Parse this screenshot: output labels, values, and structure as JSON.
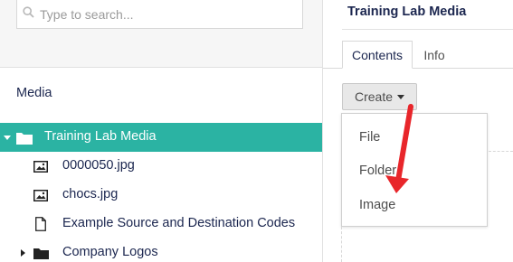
{
  "search": {
    "placeholder": "Type to search..."
  },
  "tree": {
    "header": "Media",
    "items": [
      {
        "label": "Training Lab Media"
      },
      {
        "label": "0000050.jpg"
      },
      {
        "label": "chocs.jpg"
      },
      {
        "label": "Example Source and Destination Codes"
      },
      {
        "label": "Company Logos"
      }
    ]
  },
  "detail": {
    "title": "Training Lab Media",
    "tabs": [
      {
        "label": "Contents"
      },
      {
        "label": "Info"
      }
    ],
    "create_label": "Create",
    "menu": [
      {
        "label": "File"
      },
      {
        "label": "Folder"
      },
      {
        "label": "Image"
      }
    ]
  },
  "colors": {
    "selected_bg": "#2bb3a3",
    "text": "#1b264f",
    "annotation_arrow": "#e8262b"
  }
}
